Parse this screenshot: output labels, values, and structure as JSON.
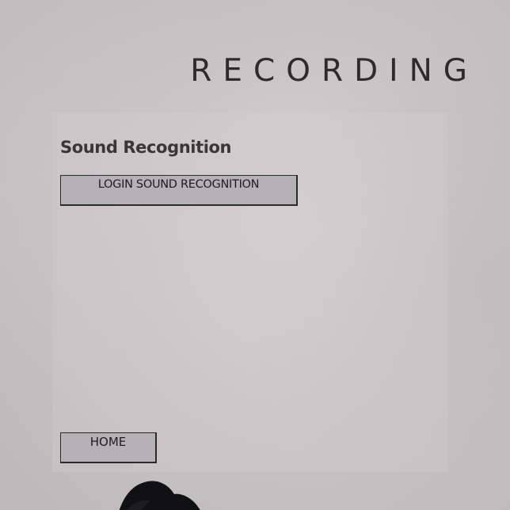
{
  "header": {
    "title": "RECORDING"
  },
  "main": {
    "section_heading": "Sound Recognition",
    "login_button_label": "LOGIN SOUND RECOGNITION",
    "home_button_label": "HOME"
  },
  "colors": {
    "background": "#c8c3c5",
    "button_fill": "#b5b2b6",
    "text_dark": "#2e2b2d"
  }
}
